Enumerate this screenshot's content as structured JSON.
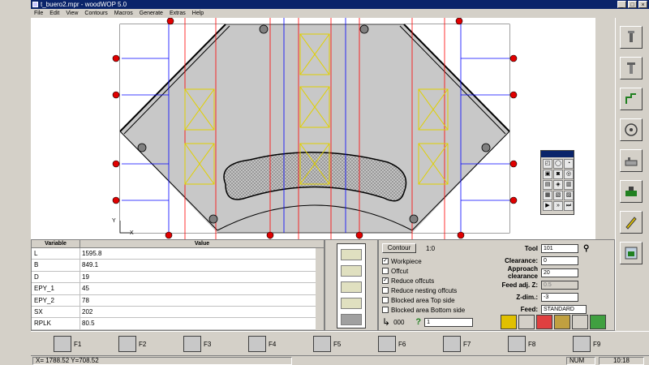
{
  "titlebar": {
    "title": "t_buero2.mpr - woodWOP 5.0"
  },
  "menu": [
    "File",
    "Edit",
    "View",
    "Contours",
    "Macros",
    "Generate",
    "Extras",
    "Help"
  ],
  "variables": {
    "header_variable": "Variable",
    "header_value": "Value",
    "rows": [
      {
        "name": "L",
        "value": "1595.8"
      },
      {
        "name": "B",
        "value": "849.1"
      },
      {
        "name": "D",
        "value": "19"
      },
      {
        "name": "EPY_1",
        "value": "45"
      },
      {
        "name": "EPY_2",
        "value": "78"
      },
      {
        "name": "SX",
        "value": "202"
      },
      {
        "name": "RPLK",
        "value": "80.5"
      }
    ]
  },
  "props": {
    "contour_label": "Contour",
    "scale": "1:0",
    "checks": [
      {
        "label": "Workpiece",
        "checked": true
      },
      {
        "label": "Offcut",
        "checked": false
      },
      {
        "label": "Reduce offcuts",
        "checked": true
      },
      {
        "label": "Reduce nesting offcuts",
        "checked": false
      },
      {
        "label": "Blocked area Top side",
        "checked": false
      },
      {
        "label": "Blocked area Bottom side",
        "checked": false
      }
    ],
    "fields": [
      {
        "label": "Tool",
        "value": "101",
        "disabled": false
      },
      {
        "label": "Clearance:",
        "value": "0",
        "disabled": false
      },
      {
        "label": "Approach clearance",
        "value": "20",
        "disabled": false
      },
      {
        "label": "Feed adj. Z:",
        "value": "0.5",
        "disabled": true
      },
      {
        "label": "Z-dim.:",
        "value": "-3",
        "disabled": false
      },
      {
        "label": "Feed:",
        "value": "STANDARD",
        "disabled": false
      }
    ],
    "code_value": "000",
    "help_value": "1"
  },
  "fkeys": [
    "F1",
    "F2",
    "F3",
    "F4",
    "F5",
    "F6",
    "F7",
    "F8",
    "F9"
  ],
  "status": {
    "coords": "X= 1788.52   Y=708.52",
    "num": "NUM",
    "time": "10:18"
  },
  "canvas": {
    "axis_y": "Y",
    "axis_x": "X"
  },
  "colors": {
    "workpiece": "#c8c8c8",
    "highlight": "#0a246a",
    "guide_red": "#ff0000",
    "guide_blue": "#0000ff",
    "box_yellow": "#e0d000"
  }
}
